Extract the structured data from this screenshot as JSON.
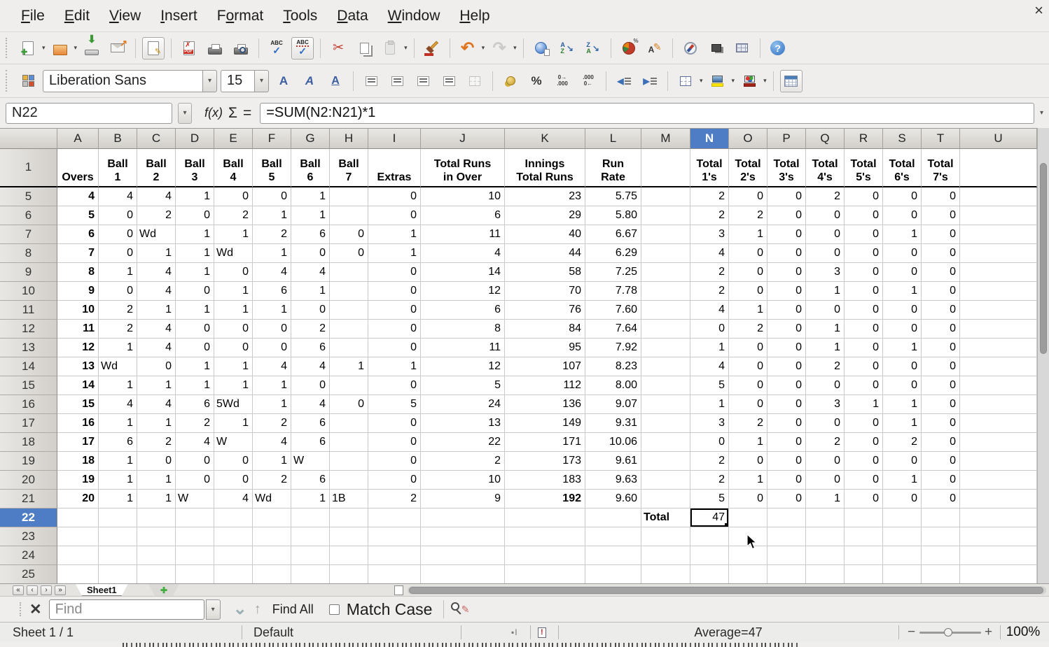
{
  "window": {
    "close_glyph": "×"
  },
  "colors": {
    "selection_header": "#4f7dc5",
    "freeze_line": "#000000",
    "grid_line": "#c9c9c9"
  },
  "menu_bar": {
    "items": [
      {
        "label": "File",
        "accel_index": 0
      },
      {
        "label": "Edit",
        "accel_index": 0
      },
      {
        "label": "View",
        "accel_index": 0
      },
      {
        "label": "Insert",
        "accel_index": 0
      },
      {
        "label": "Format",
        "accel_index": 1
      },
      {
        "label": "Tools",
        "accel_index": 0
      },
      {
        "label": "Data",
        "accel_index": 0
      },
      {
        "label": "Window",
        "accel_index": 0
      },
      {
        "label": "Help",
        "accel_index": 0
      }
    ]
  },
  "main_toolbar": {
    "buttons": [
      {
        "name": "new-document-icon",
        "dropdown": true
      },
      {
        "name": "open-icon",
        "dropdown": true
      },
      {
        "name": "save-icon"
      },
      {
        "name": "send-email-icon"
      },
      {
        "sep": true
      },
      {
        "name": "edit-mode-icon",
        "pressed": true
      },
      {
        "sep": true
      },
      {
        "name": "export-pdf-icon"
      },
      {
        "name": "print-icon"
      },
      {
        "name": "print-preview-icon"
      },
      {
        "sep": true
      },
      {
        "name": "spelling-icon"
      },
      {
        "name": "auto-spellcheck-icon",
        "pressed": true
      },
      {
        "sep": true
      },
      {
        "name": "cut-icon"
      },
      {
        "name": "copy-icon"
      },
      {
        "name": "paste-icon",
        "dropdown": true,
        "disabled": true
      },
      {
        "sep": true
      },
      {
        "name": "clone-formatting-icon"
      },
      {
        "sep": true
      },
      {
        "name": "undo-icon",
        "dropdown": true
      },
      {
        "name": "redo-icon",
        "dropdown": true,
        "disabled": true
      },
      {
        "sep": true
      },
      {
        "name": "hyperlink-icon"
      },
      {
        "name": "sort-ascending-icon"
      },
      {
        "name": "sort-descending-icon"
      },
      {
        "sep": true
      },
      {
        "name": "insert-chart-icon"
      },
      {
        "name": "show-draw-functions-icon"
      },
      {
        "sep": true
      },
      {
        "name": "navigator-icon"
      },
      {
        "name": "gallery-icon"
      },
      {
        "name": "data-sources-icon"
      },
      {
        "sep": true
      },
      {
        "name": "help-icon"
      }
    ]
  },
  "format_toolbar": {
    "font_name": "Liberation Sans",
    "font_size": "15",
    "buttons": [
      {
        "name": "bold-icon"
      },
      {
        "name": "italic-icon"
      },
      {
        "name": "underline-icon"
      },
      {
        "sep": true
      },
      {
        "name": "align-left-icon"
      },
      {
        "name": "align-center-icon"
      },
      {
        "name": "align-right-icon"
      },
      {
        "name": "align-justify-icon"
      },
      {
        "name": "merge-cells-icon",
        "disabled": true
      },
      {
        "sep": true
      },
      {
        "name": "currency-icon"
      },
      {
        "name": "percent-icon"
      },
      {
        "name": "add-decimal-icon"
      },
      {
        "name": "delete-decimal-icon"
      },
      {
        "sep": true
      },
      {
        "name": "decrease-indent-icon"
      },
      {
        "name": "increase-indent-icon"
      },
      {
        "sep": true
      },
      {
        "name": "borders-icon",
        "dropdown": true
      },
      {
        "name": "background-color-icon",
        "dropdown": true
      },
      {
        "name": "font-color-icon",
        "dropdown": true
      },
      {
        "sep": true
      },
      {
        "name": "sidebar-icon",
        "pressed": true
      }
    ]
  },
  "formula_bar": {
    "cell_reference": "N22",
    "formula": "=SUM(N2:N21)*1",
    "fx_label": "f(x)",
    "sum_label": "Σ",
    "equals_label": "="
  },
  "grid": {
    "column_letters": [
      "A",
      "B",
      "C",
      "D",
      "E",
      "F",
      "G",
      "H",
      "I",
      "J",
      "K",
      "L",
      "M",
      "N",
      "O",
      "P",
      "Q",
      "R",
      "S",
      "T",
      "U"
    ],
    "selected_column": "N",
    "selected_row": "22",
    "selected_cell_value": "47",
    "header_row": {
      "n": "1",
      "cells": [
        "Overs",
        "Ball\n1",
        "Ball\n2",
        "Ball\n3",
        "Ball\n4",
        "Ball\n5",
        "Ball\n6",
        "Ball\n7",
        "Extras",
        "Total Runs\nin Over",
        "Innings\nTotal Runs",
        "Run\nRate",
        "",
        "Total\n1's",
        "Total\n2's",
        "Total\n3's",
        "Total\n4's",
        "Total\n5's",
        "Total\n6's",
        "Total\n7's",
        ""
      ]
    },
    "rows": [
      {
        "n": "5",
        "cells": [
          "4",
          "4",
          "4",
          "1",
          "0",
          "0",
          "1",
          "",
          "0",
          "10",
          "23",
          "5.75",
          "",
          "2",
          "0",
          "0",
          "2",
          "0",
          "0",
          "0",
          ""
        ]
      },
      {
        "n": "6",
        "cells": [
          "5",
          "0",
          "2",
          "0",
          "2",
          "1",
          "1",
          "",
          "0",
          "6",
          "29",
          "5.80",
          "",
          "2",
          "2",
          "0",
          "0",
          "0",
          "0",
          "0",
          ""
        ]
      },
      {
        "n": "7",
        "cells": [
          "6",
          "0",
          "Wd",
          "1",
          "1",
          "2",
          "6",
          "0",
          "1",
          "11",
          "40",
          "6.67",
          "",
          "3",
          "1",
          "0",
          "0",
          "0",
          "1",
          "0",
          ""
        ]
      },
      {
        "n": "8",
        "cells": [
          "7",
          "0",
          "1",
          "1",
          "Wd",
          "1",
          "0",
          "0",
          "1",
          "4",
          "44",
          "6.29",
          "",
          "4",
          "0",
          "0",
          "0",
          "0",
          "0",
          "0",
          ""
        ]
      },
      {
        "n": "9",
        "cells": [
          "8",
          "1",
          "4",
          "1",
          "0",
          "4",
          "4",
          "",
          "0",
          "14",
          "58",
          "7.25",
          "",
          "2",
          "0",
          "0",
          "3",
          "0",
          "0",
          "0",
          ""
        ]
      },
      {
        "n": "10",
        "cells": [
          "9",
          "0",
          "4",
          "0",
          "1",
          "6",
          "1",
          "",
          "0",
          "12",
          "70",
          "7.78",
          "",
          "2",
          "0",
          "0",
          "1",
          "0",
          "1",
          "0",
          ""
        ]
      },
      {
        "n": "11",
        "cells": [
          "10",
          "2",
          "1",
          "1",
          "1",
          "1",
          "0",
          "",
          "0",
          "6",
          "76",
          "7.60",
          "",
          "4",
          "1",
          "0",
          "0",
          "0",
          "0",
          "0",
          ""
        ]
      },
      {
        "n": "12",
        "cells": [
          "11",
          "2",
          "4",
          "0",
          "0",
          "0",
          "2",
          "",
          "0",
          "8",
          "84",
          "7.64",
          "",
          "0",
          "2",
          "0",
          "1",
          "0",
          "0",
          "0",
          ""
        ]
      },
      {
        "n": "13",
        "cells": [
          "12",
          "1",
          "4",
          "0",
          "0",
          "0",
          "6",
          "",
          "0",
          "11",
          "95",
          "7.92",
          "",
          "1",
          "0",
          "0",
          "1",
          "0",
          "1",
          "0",
          ""
        ]
      },
      {
        "n": "14",
        "cells": [
          "13",
          "Wd",
          "0",
          "1",
          "1",
          "4",
          "4",
          "1",
          "1",
          "12",
          "107",
          "8.23",
          "",
          "4",
          "0",
          "0",
          "2",
          "0",
          "0",
          "0",
          ""
        ]
      },
      {
        "n": "15",
        "cells": [
          "14",
          "1",
          "1",
          "1",
          "1",
          "1",
          "0",
          "",
          "0",
          "5",
          "112",
          "8.00",
          "",
          "5",
          "0",
          "0",
          "0",
          "0",
          "0",
          "0",
          ""
        ]
      },
      {
        "n": "16",
        "cells": [
          "15",
          "4",
          "4",
          "6",
          "5Wd",
          "1",
          "4",
          "0",
          "5",
          "24",
          "136",
          "9.07",
          "",
          "1",
          "0",
          "0",
          "3",
          "1",
          "1",
          "0",
          ""
        ]
      },
      {
        "n": "17",
        "cells": [
          "16",
          "1",
          "1",
          "2",
          "1",
          "2",
          "6",
          "",
          "0",
          "13",
          "149",
          "9.31",
          "",
          "3",
          "2",
          "0",
          "0",
          "0",
          "1",
          "0",
          ""
        ]
      },
      {
        "n": "18",
        "cells": [
          "17",
          "6",
          "2",
          "4",
          "W",
          "4",
          "6",
          "",
          "0",
          "22",
          "171",
          "10.06",
          "",
          "0",
          "1",
          "0",
          "2",
          "0",
          "2",
          "0",
          ""
        ]
      },
      {
        "n": "19",
        "cells": [
          "18",
          "1",
          "0",
          "0",
          "0",
          "1",
          "W",
          "",
          "0",
          "2",
          "173",
          "9.61",
          "",
          "2",
          "0",
          "0",
          "0",
          "0",
          "0",
          "0",
          ""
        ]
      },
      {
        "n": "20",
        "cells": [
          "19",
          "1",
          "1",
          "0",
          "0",
          "2",
          "6",
          "",
          "0",
          "10",
          "183",
          "9.63",
          "",
          "2",
          "1",
          "0",
          "0",
          "0",
          "1",
          "0",
          ""
        ]
      },
      {
        "n": "21",
        "cells": [
          "20",
          "1",
          "1",
          "W",
          "4",
          "Wd",
          "1",
          "1B",
          "2",
          "9",
          "192",
          "9.60",
          "",
          "5",
          "0",
          "0",
          "1",
          "0",
          "0",
          "0",
          ""
        ]
      },
      {
        "n": "22",
        "cells": [
          "",
          "",
          "",
          "",
          "",
          "",
          "",
          "",
          "",
          "",
          "",
          "",
          "Total",
          "47",
          "",
          "",
          "",
          "",
          "",
          "",
          ""
        ]
      },
      {
        "n": "23",
        "cells": [
          "",
          "",
          "",
          "",
          "",
          "",
          "",
          "",
          "",
          "",
          "",
          "",
          "",
          "",
          "",
          "",
          "",
          "",
          "",
          "",
          ""
        ]
      },
      {
        "n": "24",
        "cells": [
          "",
          "",
          "",
          "",
          "",
          "",
          "",
          "",
          "",
          "",
          "",
          "",
          "",
          "",
          "",
          "",
          "",
          "",
          "",
          "",
          ""
        ]
      },
      {
        "n": "25",
        "cells": [
          "",
          "",
          "",
          "",
          "",
          "",
          "",
          "",
          "",
          "",
          "",
          "",
          "",
          "",
          "",
          "",
          "",
          "",
          "",
          "",
          ""
        ]
      }
    ],
    "bold_columns": [
      "A"
    ],
    "bold_cells": [
      [
        "K",
        "21"
      ],
      [
        "M",
        "22"
      ]
    ]
  },
  "sheet_tabs": {
    "active_tab": "Sheet1"
  },
  "find_bar": {
    "placeholder": "Find",
    "find_all_label": "Find All",
    "match_case_label": "Match Case"
  },
  "status_bar": {
    "sheet_info": "Sheet 1 / 1",
    "page_style": "Default",
    "selection_summary": "Average=47",
    "zoom_level": "100%",
    "zoom_minus": "−",
    "zoom_plus": "+"
  },
  "icon_glyphs": {
    "caret": "▾",
    "undo": "↶",
    "redo": "↷",
    "cut": "✂",
    "percent": "%",
    "nav-first": "«",
    "nav-prev": "‹",
    "nav-next": "›",
    "nav-last": "»",
    "add-sheet": "✚",
    "find-close": "✕",
    "find-next": "⌄",
    "find-prev": "↑",
    "formula-expand": "▾",
    "help": "?"
  }
}
